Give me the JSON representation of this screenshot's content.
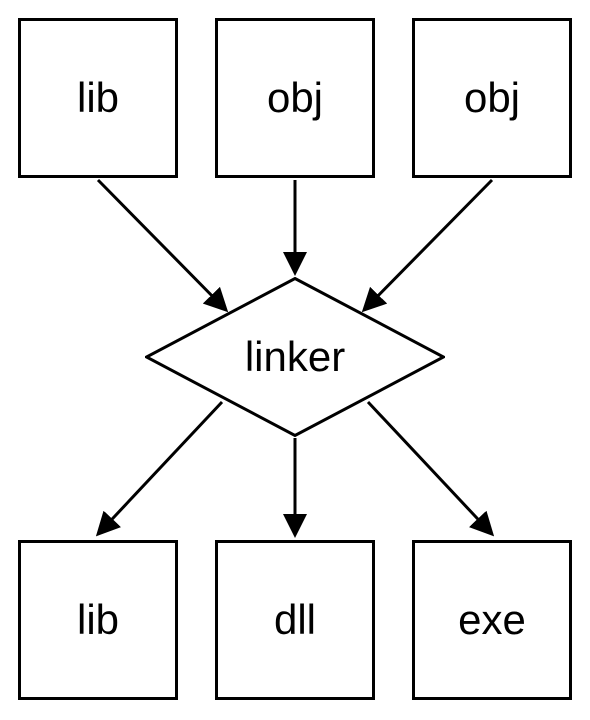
{
  "inputs": {
    "box1": "lib",
    "box2": "obj",
    "box3": "obj"
  },
  "process": "linker",
  "outputs": {
    "box1": "lib",
    "box2": "dll",
    "box3": "exe"
  }
}
